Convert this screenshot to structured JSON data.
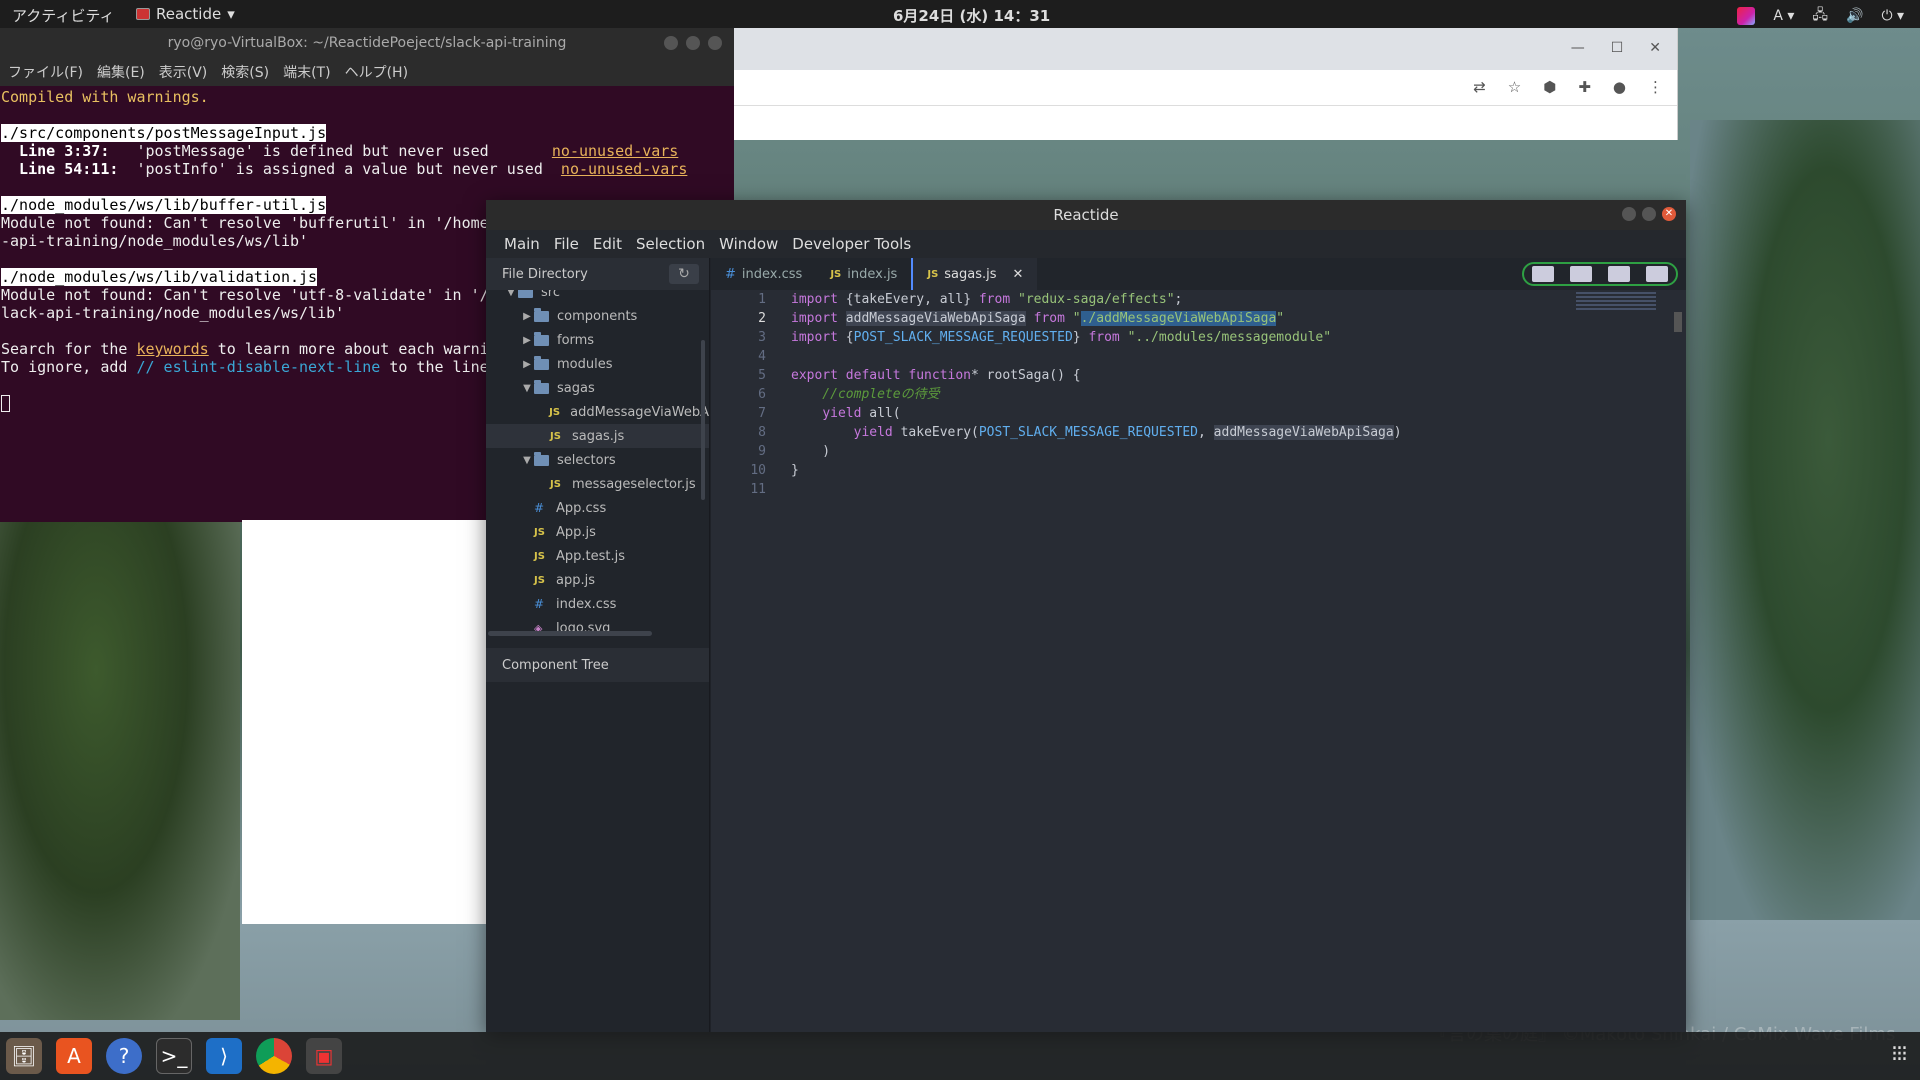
{
  "topbar": {
    "activities": "アクティビティ",
    "app_name": "Reactide",
    "clock": "6月24日 (水) 14：31",
    "input_method": "A"
  },
  "terminal": {
    "title": "ryo@ryo-VirtualBox: ~/ReactidePoeject/slack-api-training",
    "menu": [
      "ファイル(F)",
      "編集(E)",
      "表示(V)",
      "検索(S)",
      "端末(T)",
      "ヘルプ(H)"
    ],
    "compiled": "Compiled with warnings.",
    "file1": "./src/components/postMessageInput.js",
    "l1_prefix": "  Line 3:37:",
    "l1_msg": "   'postMessage' is defined but never used       ",
    "l2_prefix": "  Line 54:11:",
    "l2_msg": "  'postInfo' is assigned a value but never used  ",
    "rule": "no-unused-vars",
    "file2": "./node_modules/ws/lib/buffer-util.js",
    "err2a": "Module not found: Can't resolve 'bufferutil' in '/home",
    "err2b": "-api-training/node_modules/ws/lib'",
    "file3": "./node_modules/ws/lib/validation.js",
    "err3a": "Module not found: Can't resolve 'utf-8-validate' in '/",
    "err3b": "lack-api-training/node_modules/ws/lib'",
    "search_pre": "Search for the ",
    "search_kw": "keywords",
    "search_post": " to learn more about each warni",
    "ignore_pre": "To ignore, add ",
    "ignore_cm": "// eslint-disable-next-line",
    "ignore_post": " to the line"
  },
  "reactide": {
    "title": "Reactide",
    "menu": [
      "Main",
      "File",
      "Edit",
      "Selection",
      "Window",
      "Developer Tools"
    ],
    "file_directory": "File Directory",
    "component_tree": "Component Tree",
    "tree": [
      {
        "label": "src",
        "type": "folder",
        "depth": 0,
        "open": true
      },
      {
        "label": "components",
        "type": "folder",
        "depth": 1,
        "open": false
      },
      {
        "label": "forms",
        "type": "folder",
        "depth": 1,
        "open": false
      },
      {
        "label": "modules",
        "type": "folder",
        "depth": 1,
        "open": false
      },
      {
        "label": "sagas",
        "type": "folder",
        "depth": 1,
        "open": true
      },
      {
        "label": "addMessageViaWebA",
        "type": "js",
        "depth": 2
      },
      {
        "label": "sagas.js",
        "type": "js",
        "depth": 2,
        "selected": true
      },
      {
        "label": "selectors",
        "type": "folder",
        "depth": 1,
        "open": true
      },
      {
        "label": "messageselector.js",
        "type": "js",
        "depth": 2
      },
      {
        "label": "App.css",
        "type": "css",
        "depth": 1
      },
      {
        "label": "App.js",
        "type": "js",
        "depth": 1
      },
      {
        "label": "App.test.js",
        "type": "js",
        "depth": 1
      },
      {
        "label": "app.js",
        "type": "js",
        "depth": 1
      },
      {
        "label": "index.css",
        "type": "css",
        "depth": 1
      },
      {
        "label": "logo.svg",
        "type": "svg",
        "depth": 1
      }
    ],
    "tabs": [
      {
        "label": "index.css",
        "type": "css"
      },
      {
        "label": "index.js",
        "type": "js"
      },
      {
        "label": "sagas.js",
        "type": "js",
        "active": true
      }
    ],
    "code": {
      "l1a": "import ",
      "l1b": "{takeEvery, all} ",
      "l1c": "from ",
      "l1d": "\"redux-saga/effects\"",
      "l1e": ";",
      "l2a": "import ",
      "l2b": "addMessageViaWebApiSaga",
      "l2c": " from ",
      "l2d": "\"",
      "l2e": "./addMessageViaWebApiSaga",
      "l2f": "\"",
      "l3a": "import ",
      "l3b": "{",
      "l3c": "POST_SLACK_MESSAGE_REQUESTED",
      "l3d": "} ",
      "l3e": "from ",
      "l3f": "\"../modules/messagemodule\"",
      "l5a": "export default function",
      "l5b": "* rootSaga() {",
      "l6": "    //completeの待受",
      "l7a": "    ",
      "l7b": "yield",
      "l7c": " all(",
      "l8a": "        ",
      "l8b": "yield",
      "l8c": " takeEvery(",
      "l8d": "POST_SLACK_MESSAGE_REQUESTED",
      "l8e": ", ",
      "l8f": "addMessageViaWebApiSaga",
      "l8g": ")",
      "l9": "    )",
      "l10": "}",
      "line_numbers": [
        "1",
        "2",
        "3",
        "4",
        "5",
        "6",
        "7",
        "8",
        "9",
        "10",
        "11"
      ]
    }
  },
  "wallpaper_credit": "『言の葉の庭』 ©Makoto Shinkai / CoMix Wave Films"
}
